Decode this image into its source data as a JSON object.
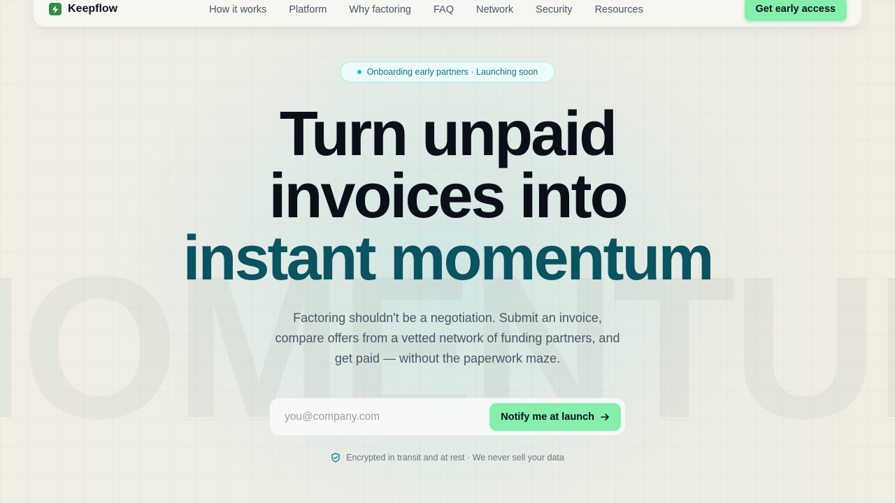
{
  "brand": {
    "name": "Keepflow",
    "logo_icon": "bolt-icon",
    "logo_color": "#2f8f48"
  },
  "nav": {
    "links": [
      "How it works",
      "Platform",
      "Why factoring",
      "FAQ",
      "Network",
      "Security",
      "Resources"
    ],
    "cta_label": "Get early access"
  },
  "badge": {
    "text": "Onboarding early partners · Launching soon",
    "dot_color": "#06c3d6"
  },
  "hero": {
    "line1": "Turn unpaid",
    "line2": "invoices into",
    "line3": "instant momentum",
    "background_word": "MOMENTUM",
    "subtitle": "Factoring shouldn't be a negotiation. Submit an invoice, compare offers from a vetted network of funding partners, and get paid — without the paperwork maze."
  },
  "signup": {
    "placeholder": "you@company.com",
    "value": "",
    "button_label": "Notify me at launch",
    "button_icon": "arrow-right-icon"
  },
  "security_note": {
    "icon": "shield-check-icon",
    "text": "Encrypted in transit and at rest · We never sell your data"
  },
  "colors": {
    "accent_green": "#86efac",
    "headline_accent": "#0b5361",
    "badge_border": "#a5ecf0"
  }
}
